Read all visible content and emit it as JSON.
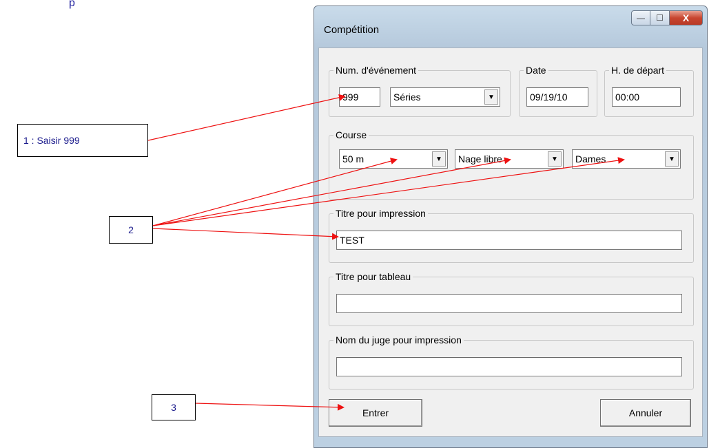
{
  "document": {
    "header_fragment": "p"
  },
  "callouts": {
    "step1": "1 :  Saisir 999",
    "step2": "2",
    "step3": "3"
  },
  "window": {
    "title": "Compétition",
    "controls": {
      "minimize": "—",
      "maximize": "☐",
      "close": "X"
    }
  },
  "event": {
    "label": "Num. d'événement",
    "number_value": "999",
    "type_value": "Séries"
  },
  "date": {
    "label": "Date",
    "value": "09/19/10"
  },
  "start_time": {
    "label": "H. de départ",
    "value": "00:00"
  },
  "course": {
    "label": "Course",
    "distance": "50 m",
    "stroke": "Nage libre",
    "gender": "Dames"
  },
  "print_title": {
    "label": "Titre pour impression",
    "value": "TEST"
  },
  "board_title": {
    "label": "Titre pour tableau",
    "value": ""
  },
  "judge_name": {
    "label": "Nom du juge pour impression",
    "value": ""
  },
  "buttons": {
    "enter": "Entrer",
    "cancel": "Annuler"
  },
  "colors": {
    "arrow": "#ee1111",
    "callout_text": "#1a1a8c"
  }
}
